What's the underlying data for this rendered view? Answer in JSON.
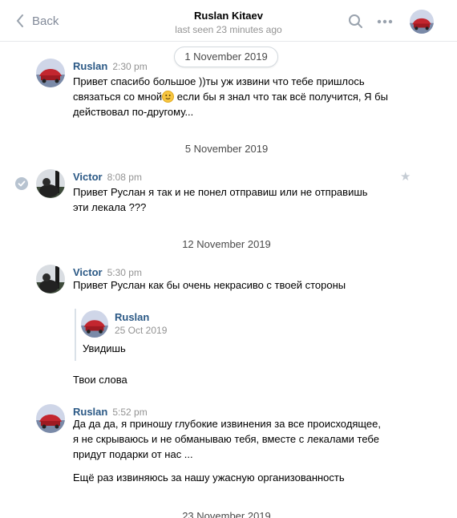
{
  "header": {
    "back_label": "Back",
    "contact_name": "Ruslan Kitaev",
    "last_seen": "last seen 23 minutes ago"
  },
  "dates": [
    "1 November 2019",
    "5 November 2019",
    "12 November 2019",
    "23 November 2019"
  ],
  "messages": [
    {
      "author": "Ruslan",
      "time": "2:30 pm",
      "text_before_emoji": "Привет спасибо большое ))ты уж извини что тебе пришлось связаться со мной",
      "text_after_emoji": " если бы я знал что так всё получится, Я бы действовал по-другому..."
    },
    {
      "author": "Victor",
      "time": "8:08 pm",
      "text": "Привет Руслан я так и не понел отправиш или не отправишь эти лекала ???"
    },
    {
      "author": "Victor",
      "time": "5:30 pm",
      "text": "Привет Руслан как бы очень некрасиво с твоей стороны",
      "forwarded": {
        "author": "Ruslan",
        "date": "25 Oct 2019",
        "text": "Увидишь"
      },
      "text_after": "Твои слова"
    },
    {
      "author": "Ruslan",
      "time": "5:52 pm",
      "text": "Да да да, я приношу глубокие извинения за все происходящее, я не скрываюсь и не обманываю тебя, вместе с лекалами тебе придут подарки от нас ...",
      "text_after": "Ещё раз извиняюсь за нашу ужасную организованность"
    }
  ],
  "icons": {
    "back": "chevron-left-icon",
    "search": "search-icon",
    "more": "more-dots-icon",
    "read": "check-icon",
    "star": "star-icon",
    "emoji": "smile-emoji-icon"
  },
  "colors": {
    "link": "#2a5885",
    "muted": "#939393",
    "divider": "#e7e8ec"
  }
}
